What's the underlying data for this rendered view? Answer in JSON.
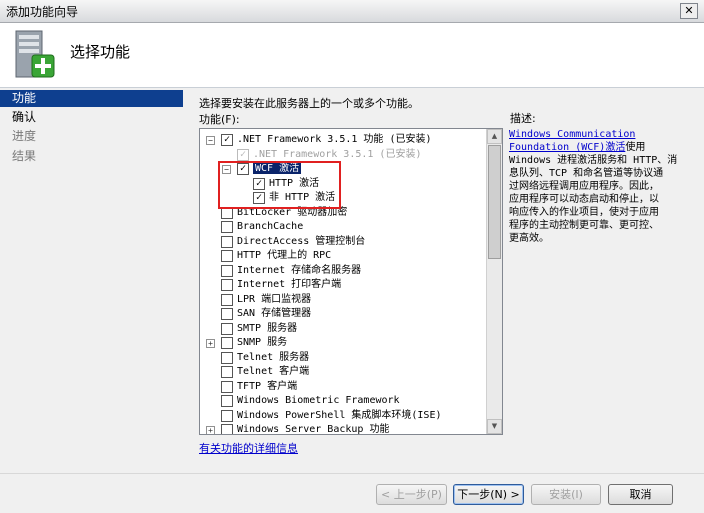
{
  "window": {
    "title": "添加功能向导",
    "close": "✕"
  },
  "header": {
    "title": "选择功能"
  },
  "sidebar": {
    "items": [
      {
        "label": "功能",
        "state": "active"
      },
      {
        "label": "确认",
        "state": "done"
      },
      {
        "label": "进度",
        "state": "pending"
      },
      {
        "label": "结果",
        "state": "pending"
      }
    ]
  },
  "main": {
    "instruction": "选择要安装在此服务器上的一个或多个功能。",
    "features_label": "功能(F):",
    "description_label": "描述:",
    "more_link": "有关功能的详细信息"
  },
  "tree": [
    {
      "label": ".NET Framework 3.5.1 功能  (已安装)",
      "expander": "⊟",
      "checked": true,
      "disabled": false,
      "indent": 0
    },
    {
      "label": ".NET Framework 3.5.1  (已安装)",
      "expander": "",
      "checked": true,
      "disabled": true,
      "indent": 1
    },
    {
      "label": "WCF 激活",
      "expander": "⊟",
      "checked": true,
      "disabled": false,
      "indent": 1,
      "selected": true
    },
    {
      "label": "HTTP 激活",
      "expander": "",
      "checked": true,
      "disabled": false,
      "indent": 2
    },
    {
      "label": "非 HTTP 激活",
      "expander": "",
      "checked": true,
      "disabled": false,
      "indent": 2
    },
    {
      "label": "BitLocker 驱动器加密",
      "expander": "",
      "checked": false,
      "indent": 0
    },
    {
      "label": "BranchCache",
      "expander": "",
      "checked": false,
      "indent": 0
    },
    {
      "label": "DirectAccess 管理控制台",
      "expander": "",
      "checked": false,
      "indent": 0
    },
    {
      "label": "HTTP 代理上的 RPC",
      "expander": "",
      "checked": false,
      "indent": 0
    },
    {
      "label": "Internet 存储命名服务器",
      "expander": "",
      "checked": false,
      "indent": 0
    },
    {
      "label": "Internet 打印客户端",
      "expander": "",
      "checked": false,
      "indent": 0
    },
    {
      "label": "LPR 端口监视器",
      "expander": "",
      "checked": false,
      "indent": 0
    },
    {
      "label": "SAN 存储管理器",
      "expander": "",
      "checked": false,
      "indent": 0
    },
    {
      "label": "SMTP 服务器",
      "expander": "",
      "checked": false,
      "indent": 0
    },
    {
      "label": "SNMP 服务",
      "expander": "⊞",
      "checked": false,
      "indent": 0
    },
    {
      "label": "Telnet 服务器",
      "expander": "",
      "checked": false,
      "indent": 0
    },
    {
      "label": "Telnet 客户端",
      "expander": "",
      "checked": false,
      "indent": 0
    },
    {
      "label": "TFTP 客户端",
      "expander": "",
      "checked": false,
      "indent": 0
    },
    {
      "label": "Windows Biometric Framework",
      "expander": "",
      "checked": false,
      "indent": 0
    },
    {
      "label": "Windows PowerShell 集成脚本环境(ISE)",
      "expander": "",
      "checked": false,
      "indent": 0
    },
    {
      "label": "Windows Server Backup 功能",
      "expander": "⊞",
      "checked": false,
      "indent": 0
    }
  ],
  "description": {
    "link_line1": "Windows Communication",
    "link_line2": "Foundation (WCF)激活",
    "line2_suffix": "使用",
    "lines": [
      "Windows 进程激活服务和 HTTP、消",
      "息队列、TCP 和命名管道等协议通",
      "过网络远程调用应用程序。因此，",
      "应用程序可以动态启动和停止，以",
      "响应传入的作业项目，使对于应用",
      "程序的主动控制更可靠、更可控、",
      "更高效。"
    ]
  },
  "buttons": {
    "prev": "< 上一步(P)",
    "next": "下一步(N) >",
    "install": "安装(I)",
    "cancel": "取消"
  },
  "colors": {
    "selection": "#0e3f8f",
    "highlight_box": "#e02020",
    "link": "#0000cc"
  }
}
